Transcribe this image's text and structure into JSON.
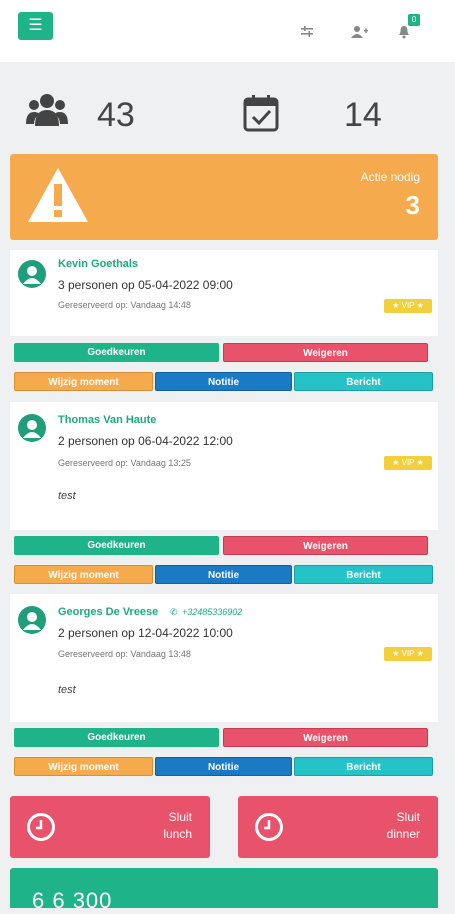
{
  "header": {
    "menu_icon": "hamburger-icon",
    "notification_count": "0",
    "icons": [
      "filter-icon",
      "add-user-icon",
      "bell-icon"
    ]
  },
  "stats": {
    "guests_icon": "users-icon",
    "guests_count": "43",
    "calendar_icon": "calendar-check-icon",
    "reservations_count": "14"
  },
  "alert": {
    "label": "Actie nodig",
    "count": "3",
    "icon": "warning-icon",
    "color": "#f5aa4d"
  },
  "reservations": [
    {
      "name": "Kevin Goethals",
      "phone": "",
      "detail": "3 personen op 05-04-2022 09:00",
      "reserved": "Gereserveerd op: Vandaag 14:48",
      "vip": "★ VIP ★",
      "note": ""
    },
    {
      "name": "Thomas Van Haute",
      "phone": "",
      "detail": "2 personen op 06-04-2022 12:00",
      "reserved": "Gereserveerd op: Vandaag 13:25",
      "vip": "★ VIP ★",
      "note": "test"
    },
    {
      "name": "Georges De Vreese",
      "phone": "+32485336902",
      "detail": "2 personen op 12-04-2022 10:00",
      "reserved": "Gereserveerd op: Vandaag 13:48",
      "vip": "★ VIP ★",
      "note": "test"
    }
  ],
  "actions": {
    "approve": "Goedkeuren",
    "reject": "Weigeren",
    "change": "Wijzig moment",
    "note": "Notitie",
    "message": "Bericht"
  },
  "close_tiles": {
    "lunch_line1": "Sluit",
    "lunch_line2": "lunch",
    "dinner_line1": "Sluit",
    "dinner_line2": "dinner"
  },
  "bottom_tile": {
    "value": "6 6 300"
  },
  "colors": {
    "green": "#1fb38a",
    "red": "#e8526a",
    "orange": "#f5aa4d",
    "blue": "#1a7bc4",
    "teal": "#25c2c7",
    "vip": "#f2cf3c"
  }
}
